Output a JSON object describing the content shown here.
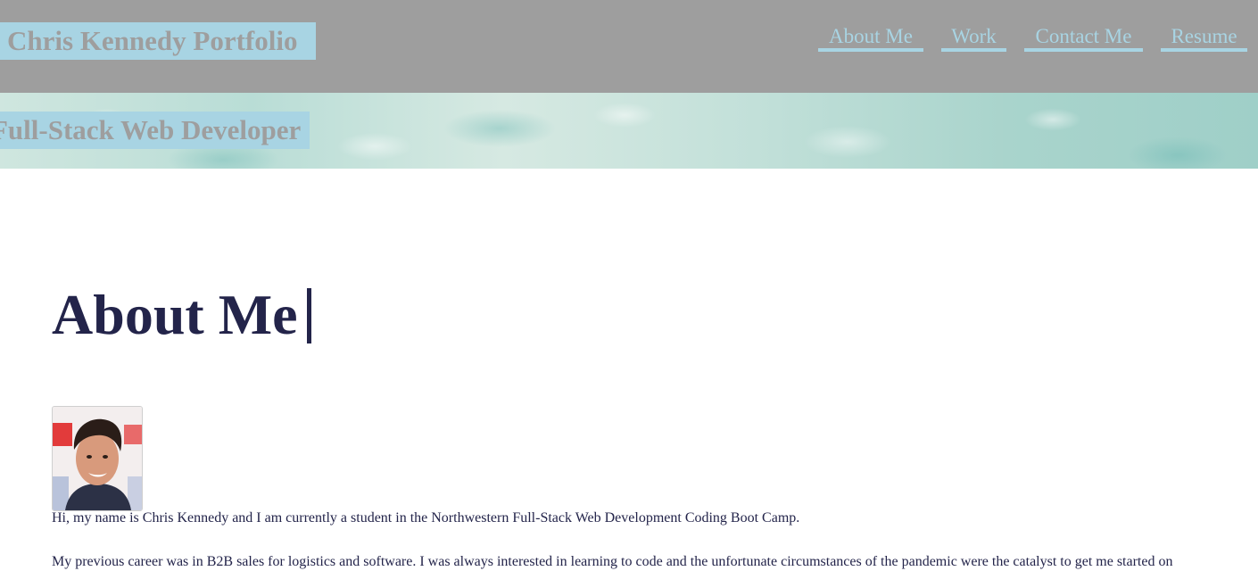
{
  "header": {
    "site_title": "Chris Kennedy Portfolio",
    "nav": [
      {
        "label": "About Me"
      },
      {
        "label": "Work"
      },
      {
        "label": "Contact Me"
      },
      {
        "label": "Resume"
      }
    ]
  },
  "hero": {
    "subtitle": "Full-Stack Web Developer"
  },
  "about": {
    "heading": "About Me",
    "paragraphs": [
      "Hi, my name is Chris Kennedy and I am currently a student in the Northwestern Full-Stack Web Development Coding Boot Camp.",
      "My previous career was in B2B sales for logistics and software. I was always interested in learning to code and the unfortunate circumstances of the pandemic were the catalyst to get me started on"
    ]
  },
  "colors": {
    "header_bg": "#9e9e9e",
    "accent": "#a8d4e3",
    "heading_text": "#23244a"
  }
}
